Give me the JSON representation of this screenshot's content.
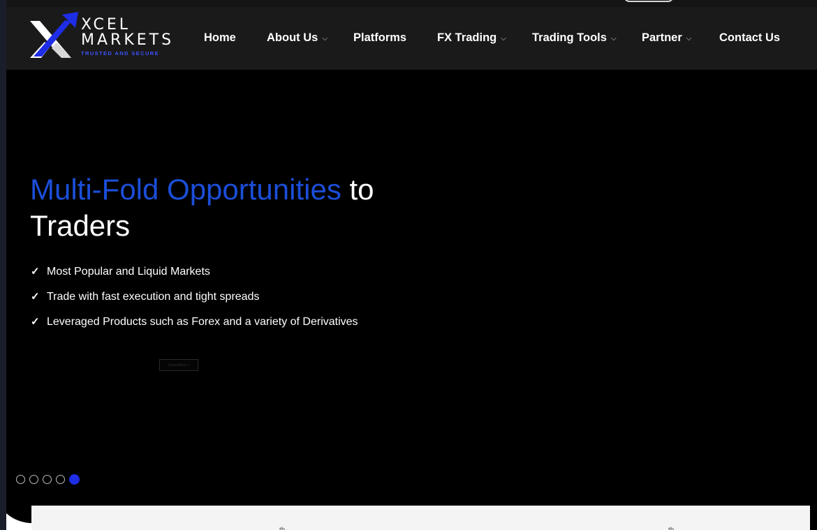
{
  "brand": {
    "line1": "XCEL",
    "line2": "MARKETS",
    "tagline": "TRUSTED AND SECURE",
    "accent_color": "#1b4ed8",
    "blue_color": "#1e2de6",
    "logo_icon": "x-arrow-logo-icon"
  },
  "nav": {
    "items": [
      {
        "label": "Home",
        "dropdown": false
      },
      {
        "label": "About Us",
        "dropdown": true
      },
      {
        "label": "Platforms",
        "dropdown": false
      },
      {
        "label": "FX Trading",
        "dropdown": true
      },
      {
        "label": "Trading Tools",
        "dropdown": true
      },
      {
        "label": "Partner",
        "dropdown": true
      },
      {
        "label": "Contact Us",
        "dropdown": false
      }
    ],
    "chevron_icon": "chevron-down-icon"
  },
  "hero": {
    "title_accent": "Multi-Fold Opportunities",
    "title_rest_1": " to",
    "title_rest_2": "Traders",
    "features": [
      "Most Popular and Liquid Markets",
      "Trade with fast execution and tight spreads",
      "Leveraged Products such as Forex and a variety of Derivatives"
    ],
    "check_icon": "check-icon",
    "button_label": "Know More »"
  },
  "slider": {
    "total": 5,
    "active_index": 5
  },
  "panel": {
    "mark_left": "th",
    "mark_right": "th"
  }
}
